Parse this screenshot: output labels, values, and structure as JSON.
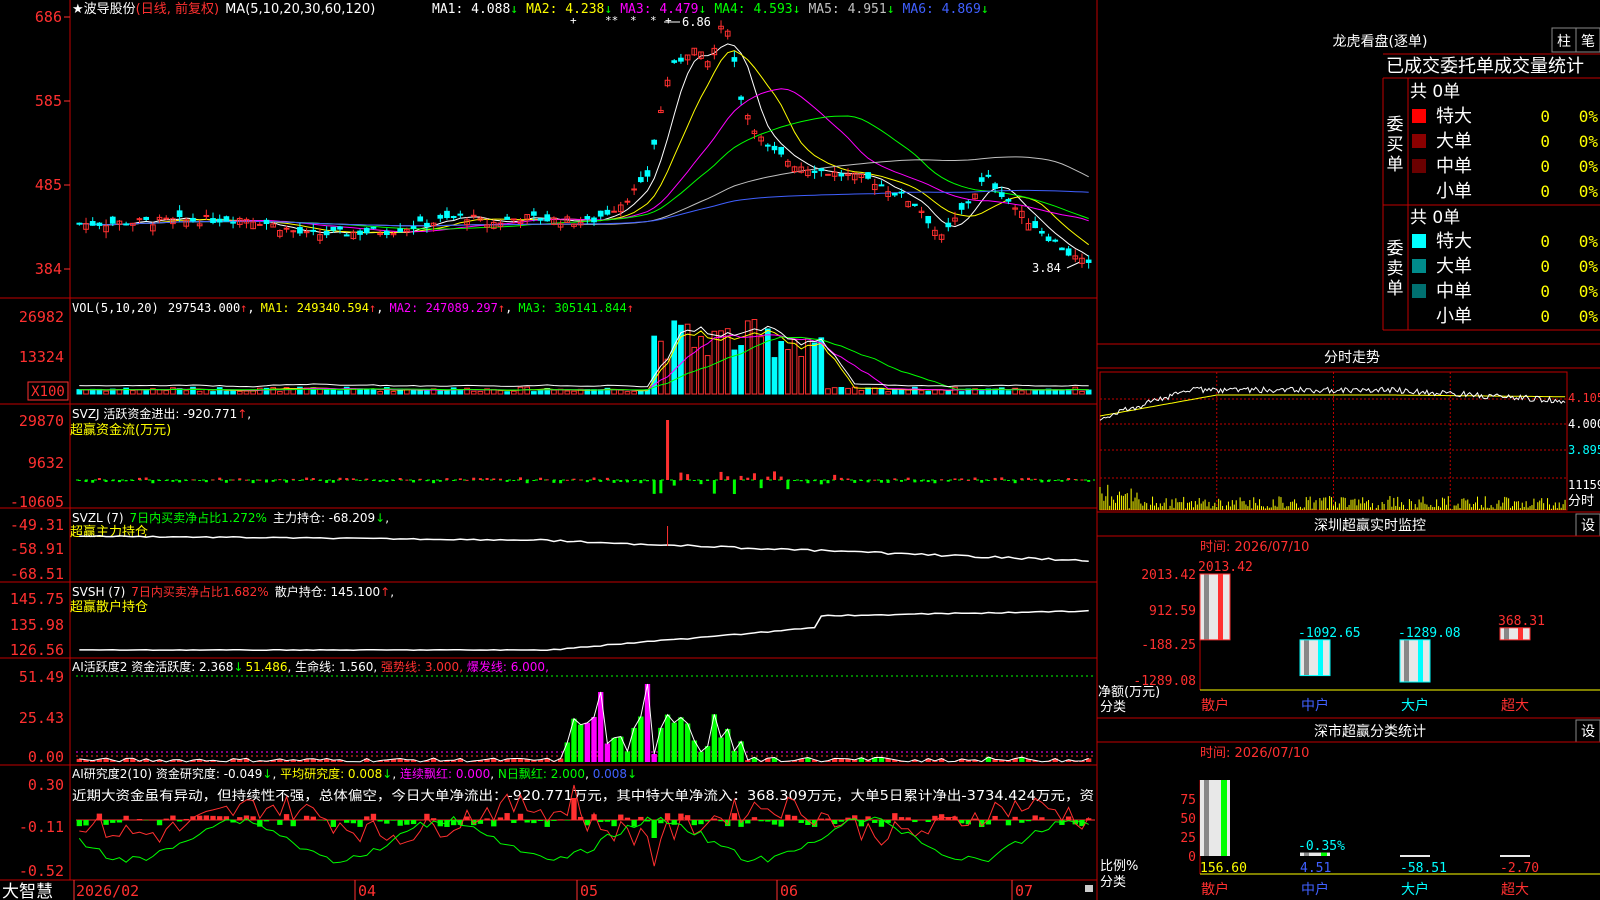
{
  "stock": {
    "star": "★",
    "name": "波导股份",
    "mode": "(日线, 前复权)"
  },
  "colors": {
    "bg": "#000000",
    "grid": "#c00000",
    "up": "#ff3030",
    "down": "#00ffff",
    "ma1": "#ffffff",
    "ma2": "#ffff00",
    "ma3": "#ff00ff",
    "ma4": "#00ff00",
    "ma5": "#c0c0c0",
    "ma6": "#4060ff",
    "green": "#00ff00",
    "yellow": "#ffff00",
    "axis_red": "#ff3030"
  },
  "main_legend": {
    "params": "MA(5,10,20,30,60,120)",
    "items": [
      {
        "label": "MA1: 4.088",
        "arrow": "↓",
        "color": "#ffffff"
      },
      {
        "label": "MA2: 4.238",
        "arrow": "↓",
        "color": "#ffff00"
      },
      {
        "label": "MA3: 4.479",
        "arrow": "↓",
        "color": "#ff00ff"
      },
      {
        "label": "MA4: 4.593",
        "arrow": "↓",
        "color": "#00ff00"
      },
      {
        "label": "MA5: 4.951",
        "arrow": "↓",
        "color": "#c0c0c0"
      },
      {
        "label": "MA6: 4.869",
        "arrow": "↓",
        "color": "#4060ff"
      }
    ]
  },
  "price_axis": {
    "ticks": [
      "686",
      "585",
      "485",
      "384"
    ],
    "high_label": "6.86",
    "low_label": "3.84"
  },
  "vol_legend": {
    "params": "VOL(5,10,20)",
    "items": [
      {
        "label": "297543.000",
        "arrow": "↑",
        "color": "#ffffff"
      },
      {
        "label": "MA1: 249340.594",
        "arrow": "↑",
        "color": "#ffff00"
      },
      {
        "label": "MA2: 247089.297",
        "arrow": "↑",
        "color": "#ff00ff"
      },
      {
        "label": "MA3: 305141.844",
        "arrow": "↑",
        "color": "#00ff00"
      }
    ],
    "axis": [
      "26982",
      "13324"
    ],
    "unit": "X100"
  },
  "svzj": {
    "title": "SVZJ  活跃资金进出: -920.771",
    "arrow": "↑",
    "sub": "超赢资金流(万元)",
    "axis": [
      "29870",
      "9632",
      "-10605"
    ]
  },
  "svzl": {
    "head": "SVZL (7)",
    "g": "7日内买卖净占比1.272%",
    "w": "主力持仓: -68.209",
    "arrow": "↓",
    "sub": "超赢主力持仓",
    "axis": [
      "-49.31",
      "-58.91",
      "-68.51"
    ]
  },
  "svsh": {
    "head": "SVSH (7)",
    "r": "7日内买卖净占比1.682%",
    "w": "散户持仓: 145.100",
    "arrow": "↑",
    "sub": "超赢散户持仓",
    "axis": [
      "145.75",
      "135.98",
      "126.56"
    ]
  },
  "ai1": {
    "a": "AI活跃度2 资金活跃度: 2.368",
    "b": "51.486",
    "c": "生命线: 1.560",
    "d": "强势线: 3.000",
    "e": "爆发线: 6.000",
    "axis": [
      "51.49",
      "25.43",
      "0.00"
    ]
  },
  "ai2": {
    "a": "AI研究度2(10) 资金研究度: -0.049",
    "b": "平均研究度: 0.008",
    "c": "连续飘红: 0.000",
    "d": "N日飘红: 2.000",
    "e": "0.008",
    "comment": "近期大资金虽有异动，但持续性不强，总体偏空，今日大单净流出：-920.771万元，其中特大单净流入：368.309万元，大单5日累计净出-3734.424万元，资",
    "axis": [
      "0.30",
      "-0.11",
      "-0.52"
    ]
  },
  "date_axis": {
    "brand": "大智慧",
    "labels": [
      "2026/02",
      "04",
      "05",
      "06",
      "07"
    ]
  },
  "dragon": {
    "title": "龙虎看盘(逐单)",
    "btn1": "柱",
    "btn2": "笔",
    "header": "已成交委托单成交量统计",
    "buy_total": "共 0单",
    "buy_label": "委买单",
    "sell_total": "共 0单",
    "sell_label": "委卖单",
    "buy_rows": [
      {
        "name": "特大",
        "value": "0",
        "pct": "0%",
        "color": "#ff0000"
      },
      {
        "name": "大单",
        "value": "0",
        "pct": "0%",
        "color": "#8b0000"
      },
      {
        "name": "中单",
        "value": "0",
        "pct": "0%",
        "color": "#6a0000"
      },
      {
        "name": "小单",
        "value": "0",
        "pct": "0%",
        "color": ""
      }
    ],
    "sell_rows": [
      {
        "name": "特大",
        "value": "0",
        "pct": "0%",
        "color": "#00ffff"
      },
      {
        "name": "大单",
        "value": "0",
        "pct": "0%",
        "color": "#008b8b"
      },
      {
        "name": "中单",
        "value": "0",
        "pct": "0%",
        "color": "#007070"
      },
      {
        "name": "小单",
        "value": "0",
        "pct": "0%",
        "color": ""
      }
    ]
  },
  "intraday": {
    "title": "分时走势",
    "price_axis": [
      "4.105",
      "4.000",
      "3.895"
    ],
    "vol_axis": [
      "11159",
      "分时"
    ]
  },
  "monitor": {
    "title": "深圳超赢实时监控",
    "btn": "设",
    "time": "时间: 2026/07/10",
    "y_axis": [
      "2013.42",
      "912.59",
      "-188.25",
      "-1289.08"
    ],
    "ylabel1": "净额(万元)",
    "ylabel2": "分类",
    "categories": [
      "散户",
      "中户",
      "大户",
      "超大"
    ],
    "values": [
      2013.42,
      -1092.65,
      -1289.08,
      368.31
    ],
    "value_labels": [
      "2013.42",
      "-1092.65",
      "-1289.08",
      "368.31"
    ]
  },
  "ratio": {
    "title": "深市超赢分类统计",
    "btn": "设",
    "time": "时间: 2026/07/10",
    "y_axis": [
      "75",
      "50",
      "25",
      "0"
    ],
    "ylabel1": "比例%",
    "ylabel2": "分类",
    "categories": [
      "散户",
      "中户",
      "大户",
      "超大"
    ],
    "values": [
      156.6,
      4.51,
      -58.51,
      -2.7
    ],
    "value_labels": [
      "156.60",
      "4.51",
      "-58.51",
      "-2.70"
    ],
    "annotation": "-0.35%"
  },
  "chart_data": [
    {
      "type": "line",
      "title": "波导股份",
      "xlabel": "",
      "ylabel": "",
      "x_ticks": [
        "2026/02",
        "04",
        "05",
        "06",
        "07"
      ],
      "ylim": [
        3.84,
        6.86
      ],
      "series": [
        {
          "name": "MA1",
          "last": 4.088
        },
        {
          "name": "MA2",
          "last": 4.238
        },
        {
          "name": "MA3",
          "last": 4.479
        },
        {
          "name": "MA4",
          "last": 4.593
        },
        {
          "name": "MA5",
          "last": 4.951
        },
        {
          "name": "MA6",
          "last": 4.869
        }
      ]
    },
    {
      "type": "bar",
      "title": "深圳超赢实时监控",
      "xlabel": "分类",
      "ylabel": "净额(万元)",
      "categories": [
        "散户",
        "中户",
        "大户",
        "超大"
      ],
      "values": [
        2013.42,
        -1092.65,
        -1289.08,
        368.31
      ],
      "ylim": [
        -1289.08,
        2013.42
      ]
    },
    {
      "type": "bar",
      "title": "深市超赢分类统计",
      "xlabel": "分类",
      "ylabel": "比例%",
      "categories": [
        "散户",
        "中户",
        "大户",
        "超大"
      ],
      "values": [
        156.6,
        4.51,
        -58.51,
        -2.7
      ],
      "ylim": [
        0,
        75
      ]
    }
  ]
}
